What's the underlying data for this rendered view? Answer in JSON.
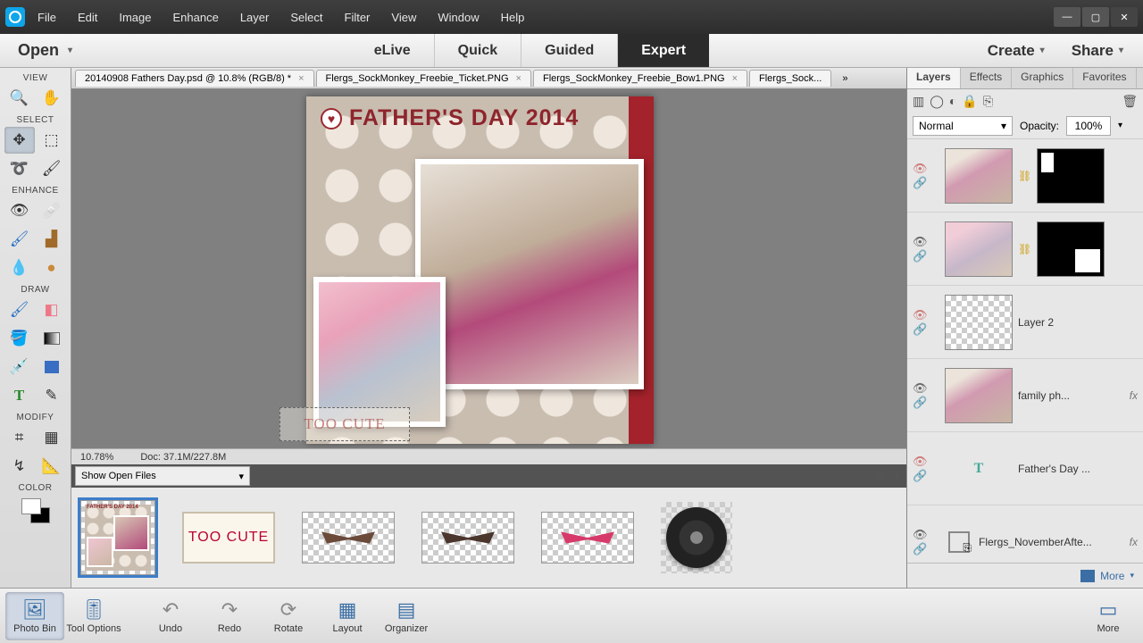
{
  "menu": [
    "File",
    "Edit",
    "Image",
    "Enhance",
    "Layer",
    "Select",
    "Filter",
    "View",
    "Window",
    "Help"
  ],
  "open_label": "Open",
  "modes": {
    "items": [
      "eLive",
      "Quick",
      "Guided",
      "Expert"
    ],
    "active": "Expert"
  },
  "top_right": {
    "create": "Create",
    "share": "Share"
  },
  "tool_sections": {
    "view": "VIEW",
    "select": "SELECT",
    "enhance": "ENHANCE",
    "draw": "DRAW",
    "modify": "MODIFY",
    "color": "COLOR"
  },
  "doc_tabs": [
    {
      "label": "20140908 Fathers Day.psd @ 10.8% (RGB/8) *",
      "close": true
    },
    {
      "label": "Flergs_SockMonkey_Freebie_Ticket.PNG",
      "close": true
    },
    {
      "label": "Flergs_SockMonkey_Freebie_Bow1.PNG",
      "close": true
    },
    {
      "label": "Flergs_Sock...",
      "close": false
    }
  ],
  "doc_overflow": "»",
  "canvas": {
    "title": "FATHER'S DAY 2014",
    "toocute": "TOO CUTE"
  },
  "status": {
    "zoom": "10.78%",
    "doc": "Doc: 37.1M/227.8M"
  },
  "open_files_dd": "Show Open Files",
  "panel_tabs": [
    "Layers",
    "Effects",
    "Graphics",
    "Favorites"
  ],
  "blend": {
    "mode": "Normal",
    "opacity_label": "Opacity:",
    "opacity_value": "100%"
  },
  "layers": [
    {
      "vis": false,
      "thumb": "photo-a",
      "mask": "tl",
      "name": "",
      "link": true
    },
    {
      "vis": true,
      "thumb": "photo-b",
      "mask": "br",
      "name": "",
      "link": true
    },
    {
      "vis": false,
      "thumb": "checker",
      "mask": null,
      "name": "Layer 2"
    },
    {
      "vis": true,
      "thumb": "photo-a",
      "mask": null,
      "name": "family ph...",
      "fx": true
    },
    {
      "vis": false,
      "thumb": "text",
      "mask": null,
      "name": "Father's Day ..."
    },
    {
      "vis": true,
      "thumb": "smart",
      "mask": null,
      "name": "Flergs_NovemberAfte...",
      "fx": true
    }
  ],
  "panel_more": "More",
  "bottom": {
    "photobin": "Photo Bin",
    "toolopts": "Tool Options",
    "undo": "Undo",
    "redo": "Redo",
    "rotate": "Rotate",
    "layout": "Layout",
    "organizer": "Organizer",
    "more": "More"
  },
  "thumbs": [
    {
      "type": "doc",
      "label": "FATHER'S DAY 2014"
    },
    {
      "type": "ticket",
      "label": "TOO CUTE"
    },
    {
      "type": "bow",
      "color": "#6b4a3a"
    },
    {
      "type": "bow",
      "color": "#4a362c"
    },
    {
      "type": "bow",
      "color": "#d73a6a"
    },
    {
      "type": "wheel"
    }
  ]
}
